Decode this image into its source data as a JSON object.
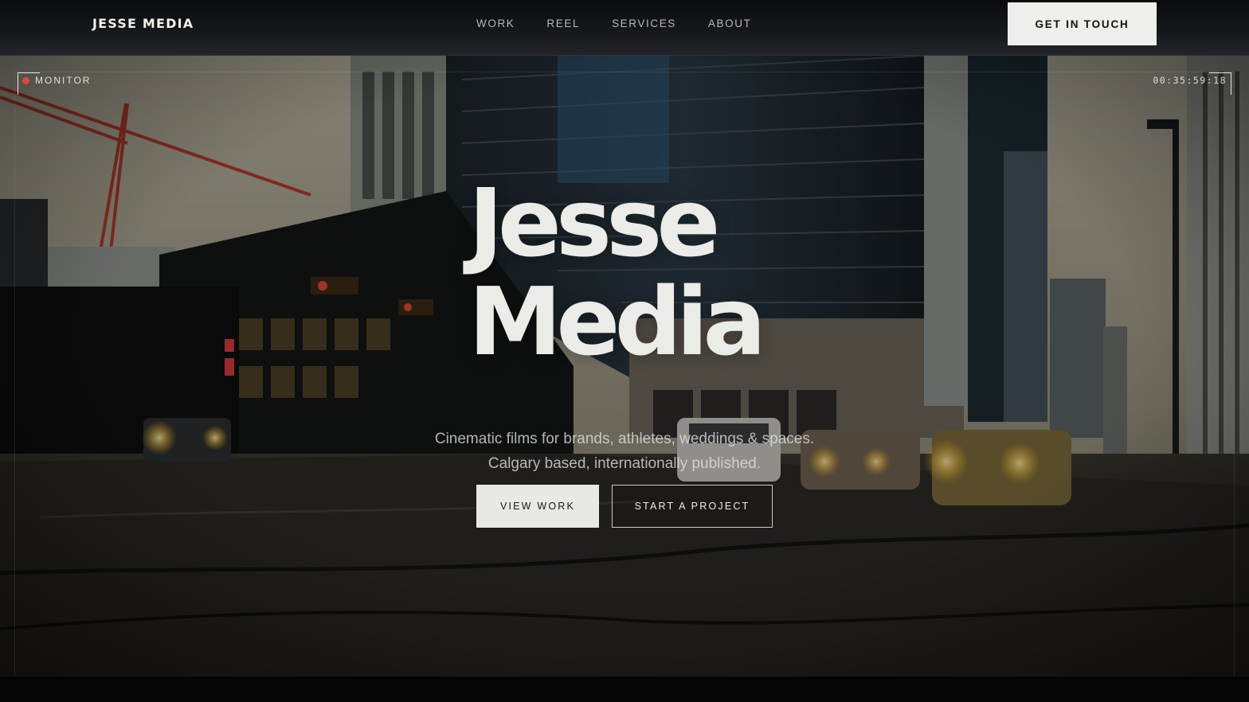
{
  "header": {
    "logo": "JESSE MEDIA",
    "nav": [
      {
        "label": "WORK"
      },
      {
        "label": "REEL"
      },
      {
        "label": "SERVICES"
      },
      {
        "label": "ABOUT"
      }
    ],
    "cta_label": "GET IN TOUCH"
  },
  "hero": {
    "monitor_label": "MONITOR",
    "timecode": "00:35:59:18",
    "title_line1": "Jesse",
    "title_line2": "Media",
    "subtitle_line1": "Cinematic films for brands, athletes, weddings & spaces.",
    "subtitle_line2": "Calgary based, internationally published.",
    "primary_button": "VIEW WORK",
    "secondary_button": "START A PROJECT",
    "background_image": "city-street-footage"
  },
  "colors": {
    "recording_dot": "#e2453d",
    "button_light": "#eeeeeb",
    "header_bg": "#111316"
  }
}
